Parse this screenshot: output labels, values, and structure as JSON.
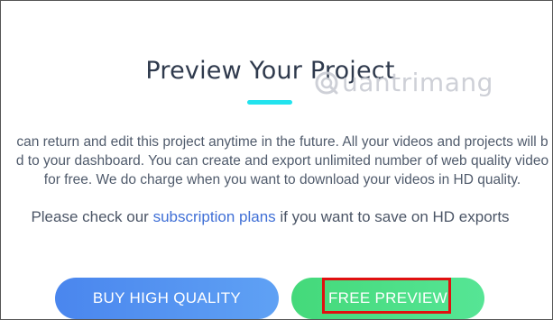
{
  "dialog": {
    "title": "Preview Your Project",
    "body_lines": [
      "can return and edit this project anytime in the future. All your videos and projects will b",
      "d to your dashboard. You can create and export unlimited number of web quality video",
      "for free. We do charge when you want to download your videos in HD quality."
    ],
    "subscribe_prefix": "Please check our ",
    "subscribe_link": "subscription plans",
    "subscribe_suffix": " if you want to save on HD exports"
  },
  "buttons": {
    "buy_label": "BUY HIGH QUALITY",
    "free_label": "FREE PREVIEW"
  },
  "watermark": {
    "text": "uantrimang",
    "icon": "logo-icon"
  },
  "colors": {
    "accent_underline": "#22e3ee",
    "buy_button": "#4f8eef",
    "free_button": "#4bdd85",
    "link": "#3f6fd6",
    "highlight": "#e01010"
  }
}
